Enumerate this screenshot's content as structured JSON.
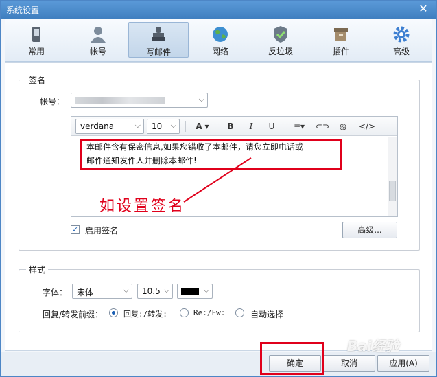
{
  "window": {
    "title": "系统设置"
  },
  "toolbar": {
    "tabs": [
      {
        "label": "常用",
        "icon": "phone-icon"
      },
      {
        "label": "帐号",
        "icon": "user-icon"
      },
      {
        "label": "写邮件",
        "icon": "stamp-icon",
        "active": true
      },
      {
        "label": "网络",
        "icon": "globe-icon"
      },
      {
        "label": "反垃圾",
        "icon": "shield-icon"
      },
      {
        "label": "插件",
        "icon": "box-icon"
      },
      {
        "label": "高级",
        "icon": "gear-icon"
      }
    ]
  },
  "signature": {
    "legend": "签名",
    "account_label": "帐号：",
    "font_name": "verdana",
    "font_size": "10",
    "toolbar_icons": [
      "font-color-icon",
      "bold-icon",
      "italic-icon",
      "underline-icon",
      "align-icon",
      "link-icon",
      "image-icon",
      "source-code-icon"
    ],
    "text_line1": "本邮件含有保密信息,如果您错收了本邮件，请您立即电话或",
    "text_line2": "邮件通知发件人并删除本邮件!",
    "enable_label": "启用签名",
    "enabled": true,
    "advanced_button": "高级..."
  },
  "annotation": {
    "text": "如设置签名",
    "color": "#e0001b"
  },
  "style": {
    "legend": "样式",
    "font_label": "字体：",
    "font_value": "宋体",
    "size_value": "10.5",
    "color_value": "#000000",
    "prefix_label": "回复/转发前缀：",
    "options": [
      "回复:/转发:",
      "Re:/Fw:",
      "自动选择"
    ],
    "selected": 0
  },
  "footer": {
    "ok": "确定",
    "cancel": "取消",
    "apply": "应用(A)"
  },
  "watermark": "Bai经验"
}
